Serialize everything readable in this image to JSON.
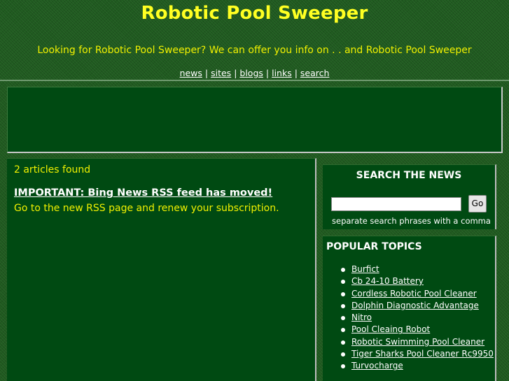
{
  "header": {
    "title": "Robotic Pool Sweeper",
    "tagline": "Looking for Robotic Pool Sweeper? We can offer you info on . . and Robotic Pool Sweeper",
    "nav": [
      {
        "label": "news"
      },
      {
        "label": "sites"
      },
      {
        "label": "blogs"
      },
      {
        "label": "links"
      },
      {
        "label": "search"
      }
    ],
    "nav_separator": "|"
  },
  "main": {
    "count": "2 articles found",
    "article": {
      "title": "IMPORTANT: Bing News RSS feed has moved!",
      "description": "Go to the new RSS page and renew your subscription."
    }
  },
  "search": {
    "heading": "SEARCH THE NEWS",
    "input_value": "",
    "button_label": "Go",
    "hint": "separate search phrases with a comma"
  },
  "topics": {
    "heading": "POPULAR TOPICS",
    "items": [
      {
        "label": "Burfict"
      },
      {
        "label": "Cb 24-10 Battery"
      },
      {
        "label": "Cordless Robotic Pool Cleaner"
      },
      {
        "label": "Dolphin Diagnostic Advantage"
      },
      {
        "label": "Nitro"
      },
      {
        "label": "Pool Cleaing Robot"
      },
      {
        "label": "Robotic Swimming Pool Cleaner"
      },
      {
        "label": "Tiger Sharks Pool Cleaner Rc9950"
      },
      {
        "label": "Turvocharge"
      }
    ]
  },
  "colors": {
    "background": "#1f5a1f",
    "panel": "#004a12",
    "title_yellow": "#ffff22",
    "text_yellow": "#f0f000",
    "link_white": "#ffffff"
  }
}
